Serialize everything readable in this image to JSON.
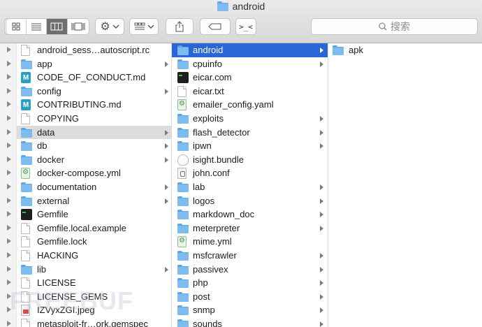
{
  "window": {
    "title": "android",
    "title_icon": "folder-icon"
  },
  "toolbar": {
    "view_modes": [
      "icon-view-icon",
      "list-view-icon",
      "column-view-icon",
      "gallery-view-icon"
    ],
    "selected_view": "column-view-icon",
    "action_icon": "gear-icon",
    "arrange_icon": "group-arrange-icon",
    "share_icon": "share-icon",
    "tag_icon": "tag-icon",
    "terminal_icon": "terminal-icon",
    "search_placeholder": "搜索"
  },
  "columns": [
    {
      "items": [
        {
          "name": "android_sess…autoscript.rc",
          "icon": "doc",
          "folder": false
        },
        {
          "name": "app",
          "icon": "folder",
          "folder": true
        },
        {
          "name": "CODE_OF_CONDUCT.md",
          "icon": "md",
          "folder": false
        },
        {
          "name": "config",
          "icon": "folder",
          "folder": true
        },
        {
          "name": "CONTRIBUTING.md",
          "icon": "md",
          "folder": false
        },
        {
          "name": "COPYING",
          "icon": "doc",
          "folder": false
        },
        {
          "name": "data",
          "icon": "folder",
          "folder": true,
          "selected": "gray"
        },
        {
          "name": "db",
          "icon": "folder",
          "folder": true
        },
        {
          "name": "docker",
          "icon": "folder",
          "folder": true
        },
        {
          "name": "docker-compose.yml",
          "icon": "yml",
          "folder": false
        },
        {
          "name": "documentation",
          "icon": "folder",
          "folder": true
        },
        {
          "name": "external",
          "icon": "folder",
          "folder": true
        },
        {
          "name": "Gemfile",
          "icon": "term",
          "folder": false
        },
        {
          "name": "Gemfile.local.example",
          "icon": "doc",
          "folder": false
        },
        {
          "name": "Gemfile.lock",
          "icon": "doc",
          "folder": false
        },
        {
          "name": "HACKING",
          "icon": "doc",
          "folder": false
        },
        {
          "name": "lib",
          "icon": "folder",
          "folder": true
        },
        {
          "name": "LICENSE",
          "icon": "doc",
          "folder": false
        },
        {
          "name": "LICENSE_GEMS",
          "icon": "doc",
          "folder": false
        },
        {
          "name": "IZVyxZGI.jpeg",
          "icon": "img",
          "folder": false
        },
        {
          "name": "metasploit-fr…ork.gemspec",
          "icon": "doc",
          "folder": false
        }
      ]
    },
    {
      "items": [
        {
          "name": "android",
          "icon": "folder",
          "folder": true,
          "selected": "blue"
        },
        {
          "name": "cpuinfo",
          "icon": "folder",
          "folder": true
        },
        {
          "name": "eicar.com",
          "icon": "term",
          "folder": false
        },
        {
          "name": "eicar.txt",
          "icon": "doc",
          "folder": false
        },
        {
          "name": "emailer_config.yaml",
          "icon": "yml",
          "folder": false
        },
        {
          "name": "exploits",
          "icon": "folder",
          "folder": true
        },
        {
          "name": "flash_detector",
          "icon": "folder",
          "folder": true
        },
        {
          "name": "ipwn",
          "icon": "folder",
          "folder": true
        },
        {
          "name": "isight.bundle",
          "icon": "bundle",
          "folder": false
        },
        {
          "name": "john.conf",
          "icon": "conf",
          "folder": false
        },
        {
          "name": "lab",
          "icon": "folder",
          "folder": true
        },
        {
          "name": "logos",
          "icon": "folder",
          "folder": true
        },
        {
          "name": "markdown_doc",
          "icon": "folder",
          "folder": true
        },
        {
          "name": "meterpreter",
          "icon": "folder",
          "folder": true
        },
        {
          "name": "mime.yml",
          "icon": "yml",
          "folder": false
        },
        {
          "name": "msfcrawler",
          "icon": "folder",
          "folder": true
        },
        {
          "name": "passivex",
          "icon": "folder",
          "folder": true
        },
        {
          "name": "php",
          "icon": "folder",
          "folder": true
        },
        {
          "name": "post",
          "icon": "folder",
          "folder": true
        },
        {
          "name": "snmp",
          "icon": "folder",
          "folder": true
        },
        {
          "name": "sounds",
          "icon": "folder",
          "folder": true
        }
      ]
    },
    {
      "items": [
        {
          "name": "apk",
          "icon": "folder",
          "folder": false
        }
      ]
    }
  ],
  "watermark": "FREEBUF"
}
